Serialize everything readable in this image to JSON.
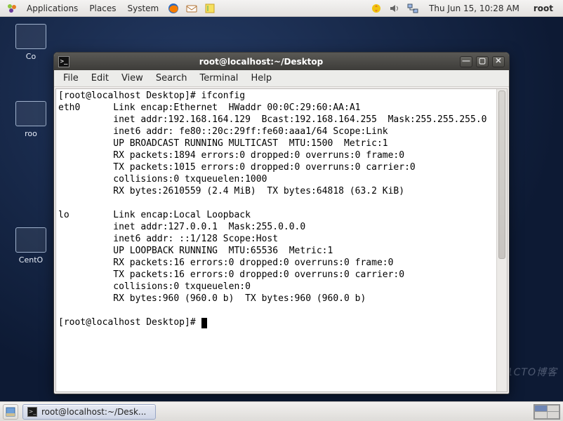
{
  "panel": {
    "apps": "Applications",
    "places": "Places",
    "system": "System",
    "clock": "Thu Jun 15, 10:28 AM",
    "user": "root"
  },
  "desktop_icons": {
    "i0": "Co",
    "i1": "roo",
    "i2": "CentO"
  },
  "window": {
    "title": "root@localhost:~/Desktop",
    "menu": {
      "file": "File",
      "edit": "Edit",
      "view": "View",
      "search": "Search",
      "terminal": "Terminal",
      "help": "Help"
    }
  },
  "terminal": {
    "line01": "[root@localhost Desktop]# ifconfig",
    "line02": "eth0      Link encap:Ethernet  HWaddr 00:0C:29:60:AA:A1",
    "line03": "          inet addr:192.168.164.129  Bcast:192.168.164.255  Mask:255.255.255.0",
    "line04": "          inet6 addr: fe80::20c:29ff:fe60:aaa1/64 Scope:Link",
    "line05": "          UP BROADCAST RUNNING MULTICAST  MTU:1500  Metric:1",
    "line06": "          RX packets:1894 errors:0 dropped:0 overruns:0 frame:0",
    "line07": "          TX packets:1015 errors:0 dropped:0 overruns:0 carrier:0",
    "line08": "          collisions:0 txqueuelen:1000",
    "line09": "          RX bytes:2610559 (2.4 MiB)  TX bytes:64818 (63.2 KiB)",
    "line10": "",
    "line11": "lo        Link encap:Local Loopback",
    "line12": "          inet addr:127.0.0.1  Mask:255.0.0.0",
    "line13": "          inet6 addr: ::1/128 Scope:Host",
    "line14": "          UP LOOPBACK RUNNING  MTU:65536  Metric:1",
    "line15": "          RX packets:16 errors:0 dropped:0 overruns:0 frame:0",
    "line16": "          TX packets:16 errors:0 dropped:0 overruns:0 carrier:0",
    "line17": "          collisions:0 txqueuelen:0",
    "line18": "          RX bytes:960 (960.0 b)  TX bytes:960 (960.0 b)",
    "line19": "",
    "prompt": "[root@localhost Desktop]# "
  },
  "taskbar": {
    "task0": "root@localhost:~/Desk..."
  }
}
